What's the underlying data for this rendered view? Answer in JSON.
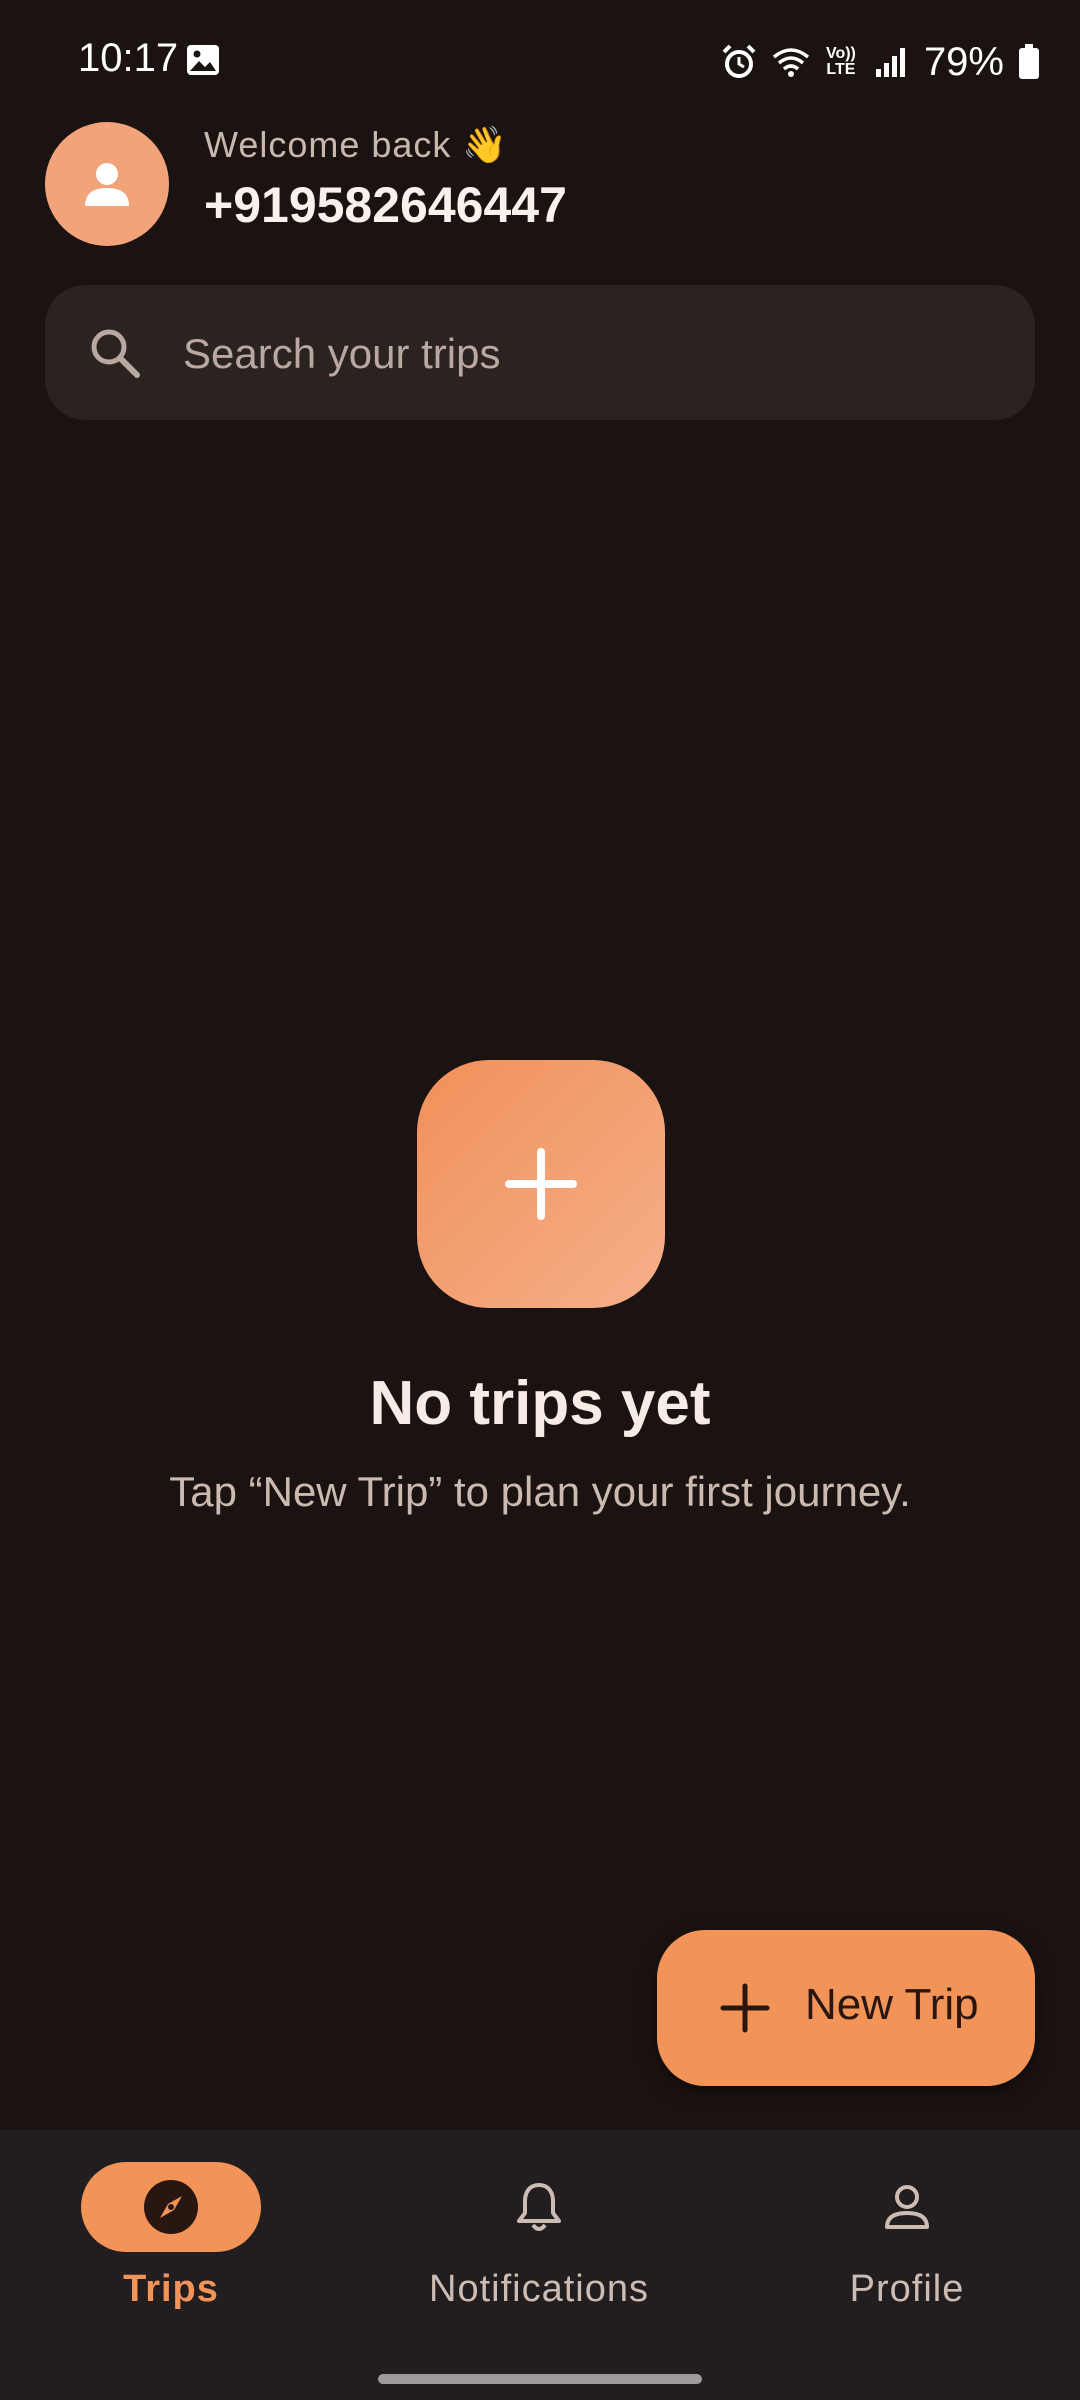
{
  "status_bar": {
    "time": "10:17",
    "battery": "79%",
    "network_label": "Vo)) LTE",
    "icons": [
      "gallery-icon",
      "alarm-icon",
      "wifi-icon",
      "signal-icon",
      "battery-icon"
    ]
  },
  "header": {
    "greeting": "Welcome back 👋",
    "user_phone": "+919582646447",
    "avatar_icon": "person-icon"
  },
  "search": {
    "placeholder": "Search your trips",
    "icon": "search-icon"
  },
  "empty_state": {
    "icon": "plus-icon",
    "title": "No trips yet",
    "subtitle": "Tap “New Trip” to plan your first journey."
  },
  "fab": {
    "label": "New Trip",
    "icon": "plus-icon"
  },
  "bottom_nav": {
    "items": [
      {
        "label": "Trips",
        "icon": "compass-icon",
        "active": true
      },
      {
        "label": "Notifications",
        "icon": "bell-icon",
        "active": false
      },
      {
        "label": "Profile",
        "icon": "person-outline-icon",
        "active": false
      }
    ]
  },
  "colors": {
    "background": "#1b1311",
    "accent": "#f29358",
    "surface": "#2b2320",
    "nav_background": "#221d1f"
  }
}
